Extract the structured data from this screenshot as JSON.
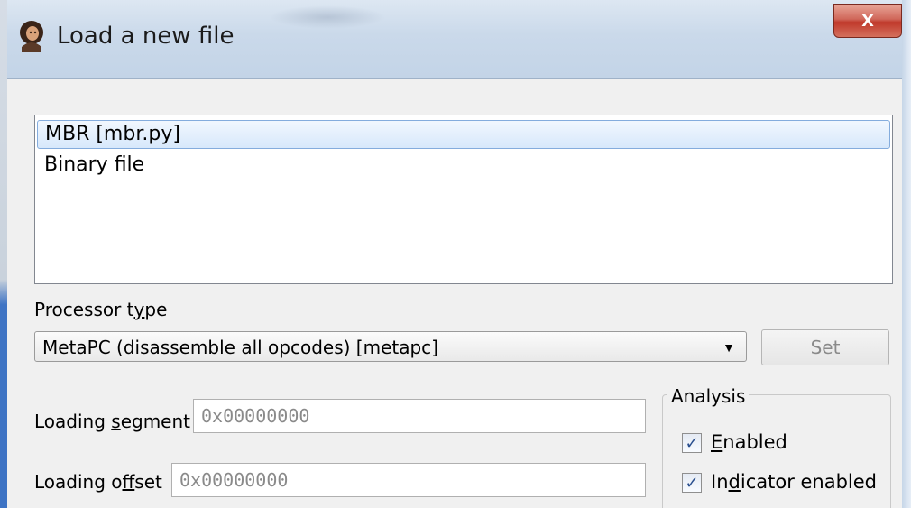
{
  "window": {
    "title": "Load a new file",
    "close_label": "x"
  },
  "loaders": {
    "items": [
      {
        "label": "MBR [mbr.py]",
        "selected": true
      },
      {
        "label": "Binary file",
        "selected": false
      }
    ]
  },
  "processor": {
    "label_pre": "Processor t",
    "label_ul": "y",
    "label_post": "pe",
    "selected": "MetaPC (disassemble all opcodes) [metapc]",
    "set_label": "Set"
  },
  "segment": {
    "label_pre": "Loading ",
    "label_ul": "s",
    "label_post": "egment",
    "value": "0x00000000"
  },
  "offset": {
    "label_pre": "Loading o",
    "label_ul": "f",
    "label_post": "fset",
    "value": "0x00000000"
  },
  "analysis": {
    "title": "Analysis",
    "enabled_ul": "E",
    "enabled_rest": "nabled",
    "enabled_checked": true,
    "indicator_pre": "In",
    "indicator_ul": "d",
    "indicator_post": "icator enabled",
    "indicator_checked": true,
    "check_glyph": "✓"
  },
  "icons": {
    "window_icon": "ida-portrait-icon",
    "dropdown": "chevron-down-icon"
  },
  "colors": {
    "selection_border": "#84acdd",
    "close_button": "#c0392b",
    "titlebar": "#c3d4e7"
  }
}
